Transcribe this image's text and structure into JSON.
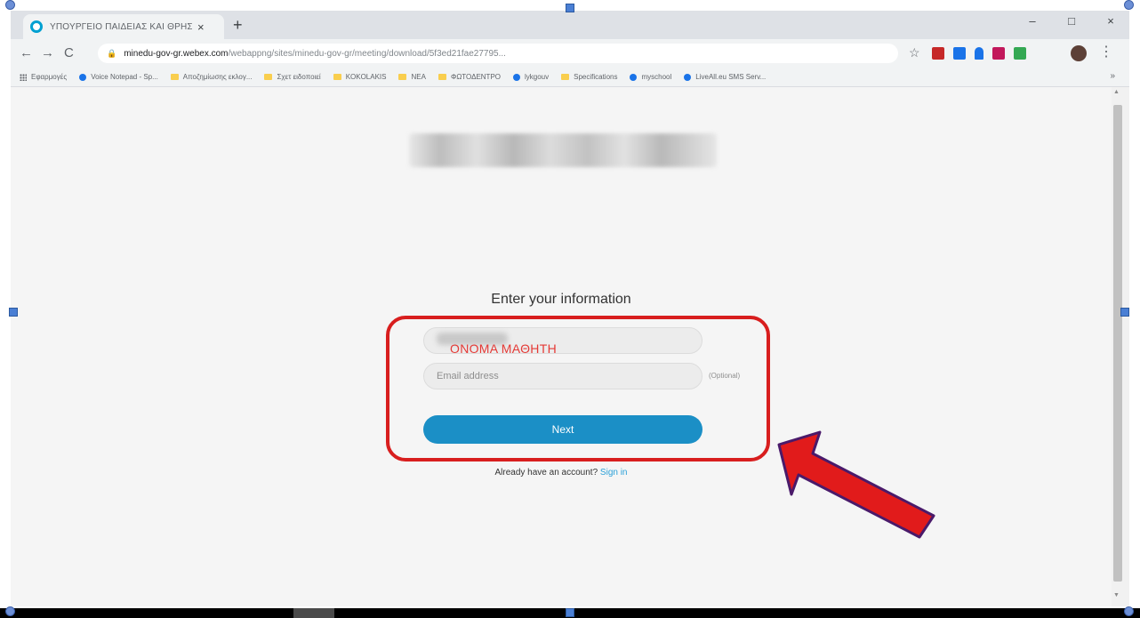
{
  "browser": {
    "tab_title": "ΥΠΟΥΡΓΕΙΟ ΠΑΙΔΕΙΑΣ ΚΑΙ ΘΡΗΣ",
    "tab_close": "×",
    "new_tab": "+",
    "window": {
      "minimize": "–",
      "maximize": "□",
      "close": "×"
    },
    "nav": {
      "back": "←",
      "forward": "→",
      "reload": "C"
    },
    "url_host": "minedu-gov-gr.webex.com",
    "url_path": "/webappng/sites/minedu-gov-gr/meeting/download/5f3ed21fae27795...",
    "star": "☆",
    "menu": "⋮",
    "bookmarks": [
      {
        "label": "Εφαρμογές",
        "kind": "apps"
      },
      {
        "label": "Voice Notepad - Sp...",
        "kind": "dot"
      },
      {
        "label": "Αποζημίωσης εκλογ...",
        "kind": "folder"
      },
      {
        "label": "Σχετ ειδοποιεί",
        "kind": "folder"
      },
      {
        "label": "KOKOLAKIS",
        "kind": "folder"
      },
      {
        "label": "ΝΕΑ",
        "kind": "folder"
      },
      {
        "label": "ΦΩΤΟΔΕΝΤΡΟ",
        "kind": "folder"
      },
      {
        "label": "lykgouv",
        "kind": "dot"
      },
      {
        "label": "Specifications",
        "kind": "folder"
      },
      {
        "label": "myschool",
        "kind": "dot"
      },
      {
        "label": "LiveAll.eu SMS Serv...",
        "kind": "dot"
      }
    ],
    "bookmarks_more": "»"
  },
  "form": {
    "heading": "Enter your information",
    "name_annotation": "ΟΝΟΜΑ ΜΑΘΗΤΗ",
    "email_placeholder": "Email address",
    "optional_label": "(Optional)",
    "next_label": "Next",
    "signin_prompt": "Already have an account?",
    "signin_link": "Sign in"
  },
  "colors": {
    "accent": "#1b8fc6",
    "annotation_red": "#d81e1e",
    "link": "#2aa0d8"
  }
}
